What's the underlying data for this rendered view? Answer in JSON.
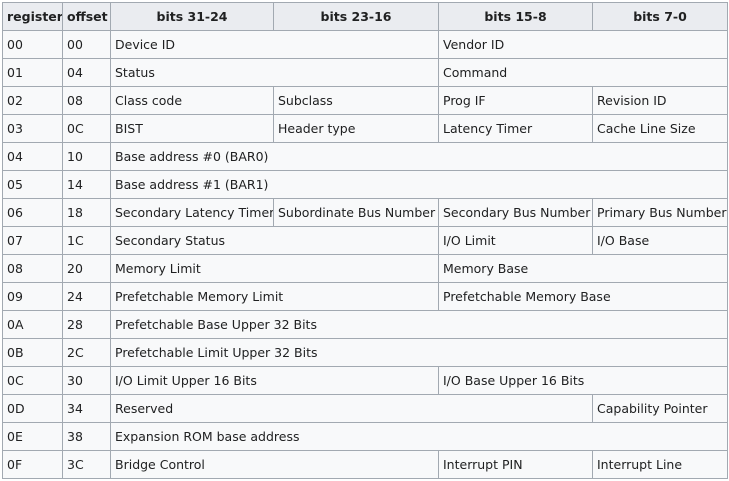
{
  "headers": [
    "register",
    "offset",
    "bits 31-24",
    "bits 23-16",
    "bits 15-8",
    "bits 7-0"
  ],
  "rows": [
    {
      "register": "00",
      "offset": "00",
      "fields": [
        {
          "text": "Device ID",
          "span": 2
        },
        {
          "text": "Vendor ID",
          "span": 2
        }
      ]
    },
    {
      "register": "01",
      "offset": "04",
      "fields": [
        {
          "text": "Status",
          "span": 2
        },
        {
          "text": "Command",
          "span": 2
        }
      ]
    },
    {
      "register": "02",
      "offset": "08",
      "fields": [
        {
          "text": "Class code",
          "span": 1
        },
        {
          "text": "Subclass",
          "span": 1
        },
        {
          "text": "Prog IF",
          "span": 1
        },
        {
          "text": "Revision ID",
          "span": 1
        }
      ]
    },
    {
      "register": "03",
      "offset": "0C",
      "fields": [
        {
          "text": "BIST",
          "span": 1
        },
        {
          "text": "Header type",
          "span": 1
        },
        {
          "text": "Latency Timer",
          "span": 1
        },
        {
          "text": "Cache Line Size",
          "span": 1
        }
      ]
    },
    {
      "register": "04",
      "offset": "10",
      "fields": [
        {
          "text": "Base address #0 (BAR0)",
          "span": 4
        }
      ]
    },
    {
      "register": "05",
      "offset": "14",
      "fields": [
        {
          "text": "Base address #1 (BAR1)",
          "span": 4
        }
      ]
    },
    {
      "register": "06",
      "offset": "18",
      "fields": [
        {
          "text": "Secondary Latency Timer",
          "span": 1
        },
        {
          "text": "Subordinate Bus Number",
          "span": 1
        },
        {
          "text": "Secondary Bus Number",
          "span": 1
        },
        {
          "text": "Primary Bus Number",
          "span": 1
        }
      ]
    },
    {
      "register": "07",
      "offset": "1C",
      "fields": [
        {
          "text": "Secondary Status",
          "span": 2
        },
        {
          "text": "I/O Limit",
          "span": 1
        },
        {
          "text": "I/O Base",
          "span": 1
        }
      ]
    },
    {
      "register": "08",
      "offset": "20",
      "fields": [
        {
          "text": "Memory Limit",
          "span": 2
        },
        {
          "text": "Memory Base",
          "span": 2
        }
      ]
    },
    {
      "register": "09",
      "offset": "24",
      "fields": [
        {
          "text": "Prefetchable Memory Limit",
          "span": 2
        },
        {
          "text": "Prefetchable Memory Base",
          "span": 2
        }
      ]
    },
    {
      "register": "0A",
      "offset": "28",
      "fields": [
        {
          "text": "Prefetchable Base Upper 32 Bits",
          "span": 4
        }
      ]
    },
    {
      "register": "0B",
      "offset": "2C",
      "fields": [
        {
          "text": "Prefetchable Limit Upper 32 Bits",
          "span": 4
        }
      ]
    },
    {
      "register": "0C",
      "offset": "30",
      "fields": [
        {
          "text": "I/O Limit Upper 16 Bits",
          "span": 2
        },
        {
          "text": "I/O Base Upper 16 Bits",
          "span": 2
        }
      ]
    },
    {
      "register": "0D",
      "offset": "34",
      "fields": [
        {
          "text": "Reserved",
          "span": 3
        },
        {
          "text": "Capability Pointer",
          "span": 1
        }
      ]
    },
    {
      "register": "0E",
      "offset": "38",
      "fields": [
        {
          "text": "Expansion ROM base address",
          "span": 4
        }
      ]
    },
    {
      "register": "0F",
      "offset": "3C",
      "fields": [
        {
          "text": "Bridge Control",
          "span": 2
        },
        {
          "text": "Interrupt PIN",
          "span": 1
        },
        {
          "text": "Interrupt Line",
          "span": 1
        }
      ]
    }
  ]
}
